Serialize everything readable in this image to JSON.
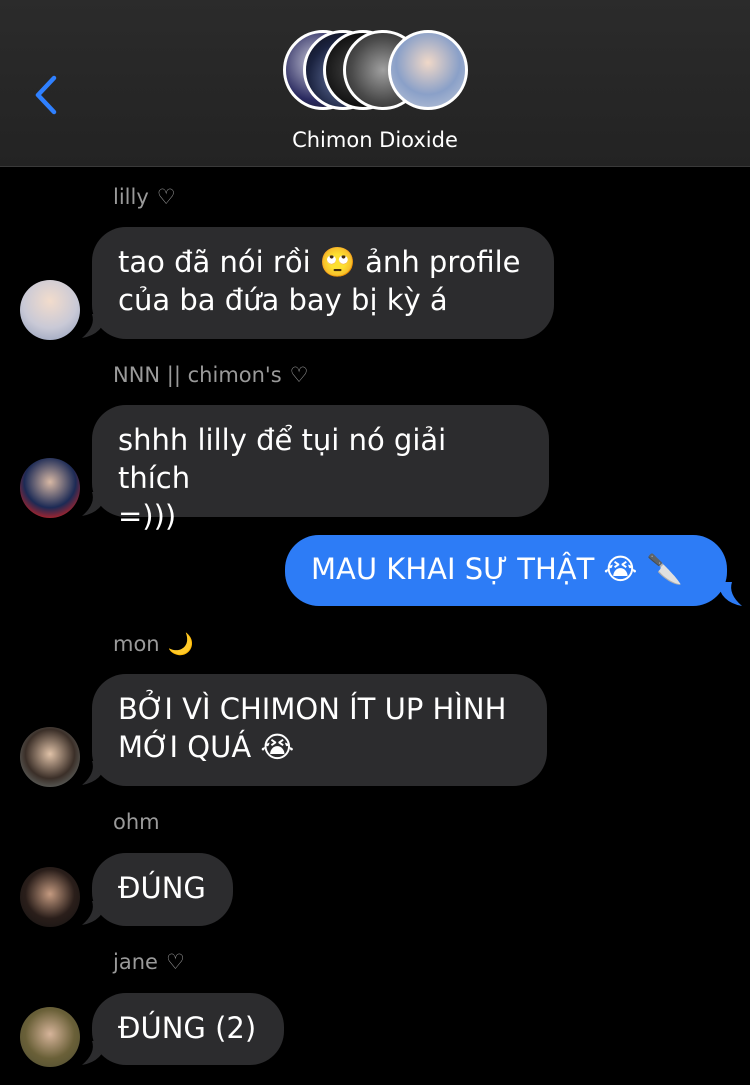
{
  "header": {
    "title": "Chimon Dioxide"
  },
  "messages": [
    {
      "sender": "lilly",
      "suffix": "♡",
      "lines": [
        "tao đã nói rồi 🙄 ảnh profile",
        "của ba đứa bay bị kỳ á"
      ]
    },
    {
      "sender": "NNN || chimon's",
      "suffix": "♡",
      "lines": [
        "shhh lilly để tụi nó giải thích",
        "=)))"
      ]
    },
    {
      "sender": "",
      "suffix": "",
      "mine": true,
      "lines": [
        "MAU KHAI SỰ THẬT 😭 🔪"
      ]
    },
    {
      "sender": "mon",
      "suffix": "🌙",
      "lines": [
        "BỞI VÌ CHIMON ÍT UP HÌNH",
        "MỚI QUÁ 😭"
      ]
    },
    {
      "sender": "ohm",
      "suffix": "",
      "lines": [
        "ĐÚNG"
      ]
    },
    {
      "sender": "jane",
      "suffix": "♡",
      "lines": [
        "ĐÚNG (2)"
      ]
    }
  ]
}
